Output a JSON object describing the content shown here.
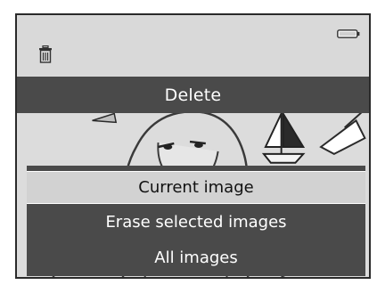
{
  "menu_title": "Delete",
  "menu_items": [
    {
      "label": "Current image",
      "selected": true
    },
    {
      "label": "Erase selected images",
      "selected": false
    },
    {
      "label": "All images",
      "selected": false
    }
  ],
  "icons": {
    "top_left": "trash-icon",
    "top_right": "battery-icon"
  },
  "colors": {
    "menu_bg": "#4a4a4a",
    "highlight_bg": "#d2d2d2",
    "screen_bg": "#dcdcdc"
  }
}
